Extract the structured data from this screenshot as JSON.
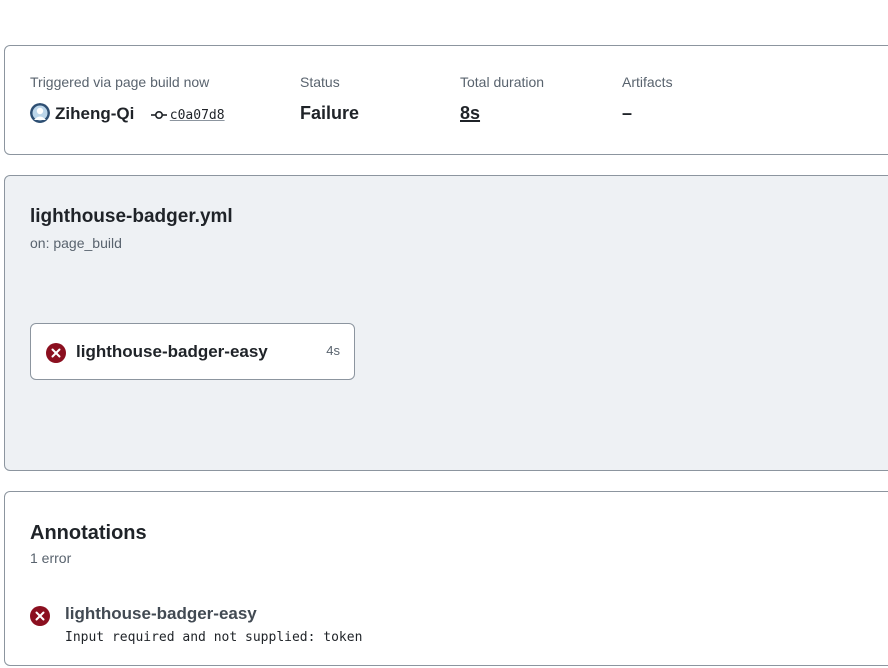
{
  "summary": {
    "trigger_label": "Triggered via page build now",
    "actor": "Ziheng-Qi",
    "commit_sha": "c0a07d8",
    "status_label": "Status",
    "status_value": "Failure",
    "duration_label": "Total duration",
    "duration_value": "8s",
    "artifacts_label": "Artifacts",
    "artifacts_value": "–"
  },
  "workflow": {
    "file": "lighthouse-badger.yml",
    "trigger": "on: page_build",
    "jobs": [
      {
        "name": "lighthouse-badger-easy",
        "duration": "4s",
        "status": "failure",
        "icon": "x-circle-icon"
      }
    ]
  },
  "annotations": {
    "title": "Annotations",
    "count": "1 error",
    "items": [
      {
        "job": "lighthouse-badger-easy",
        "message": "Input required and not supplied: token",
        "icon": "x-circle-icon"
      }
    ]
  },
  "colors": {
    "error": "#8b0f1f",
    "graph_background": "#eef1f4",
    "border": "#8c959f",
    "muted_text": "#59636e"
  }
}
